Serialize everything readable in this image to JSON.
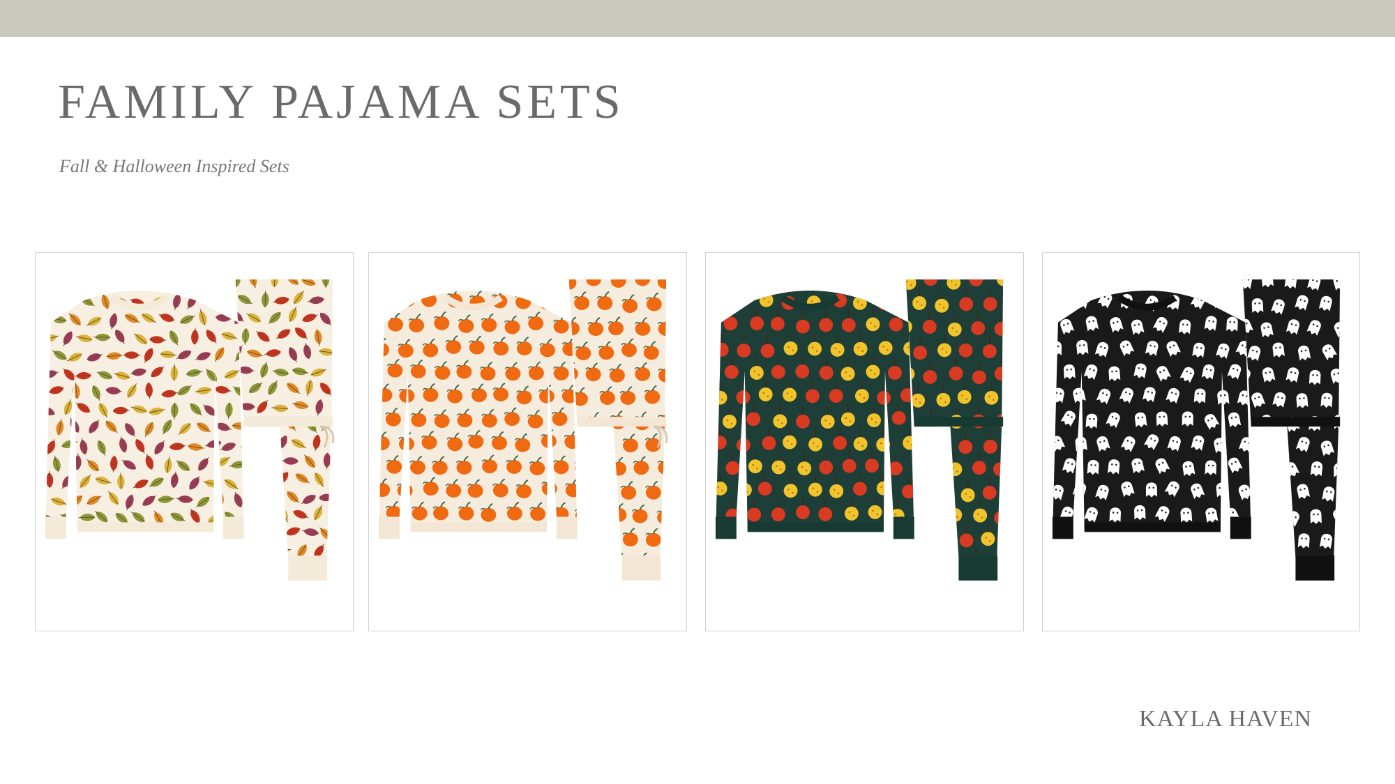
{
  "header": {
    "title": "FAMILY PAJAMA SETS",
    "subtitle": "Fall & Halloween Inspired Sets"
  },
  "products": [
    {
      "pattern": "autumn-leaves",
      "colors": {
        "fabric": "#f6efe2",
        "cuff": "#f3ead8",
        "motifs": [
          "#c9321e",
          "#e08a25",
          "#d9b43a",
          "#8a9a3a",
          "#9a3b5a"
        ]
      }
    },
    {
      "pattern": "pumpkins",
      "colors": {
        "fabric": "#f6ecde",
        "cuff": "#f3e6d4",
        "motifs": [
          "#f06a12",
          "#3d6a4e"
        ]
      }
    },
    {
      "pattern": "apples",
      "colors": {
        "fabric": "#1d3f37",
        "cuff": "#173a32",
        "motifs": [
          "#d93a22",
          "#f2c42c",
          "#3a2a20"
        ]
      }
    },
    {
      "pattern": "ghosts",
      "colors": {
        "fabric": "#1a1a1a",
        "cuff": "#111111",
        "motifs": [
          "#ffffff"
        ]
      }
    }
  ],
  "footer": {
    "brand": "KAYLA HAVEN"
  }
}
